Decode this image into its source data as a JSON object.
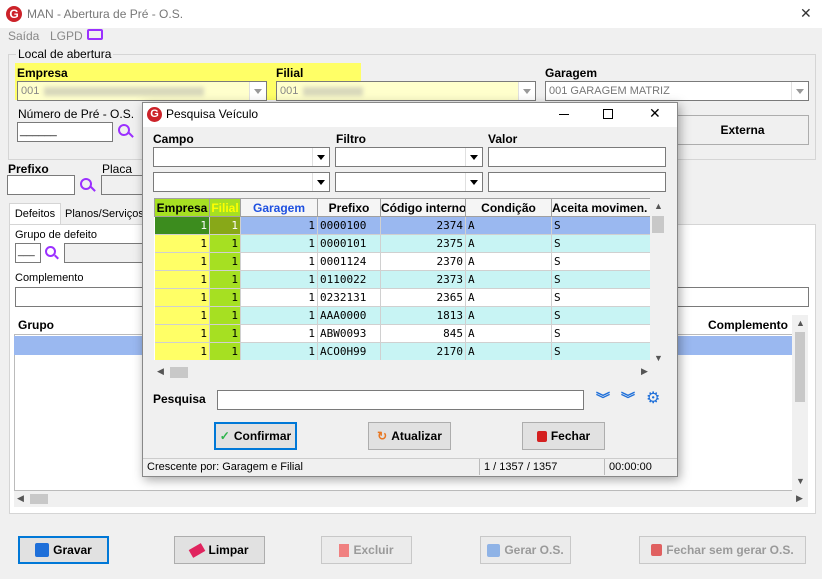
{
  "window": {
    "title": "MAN - Abertura de Pré - O.S.",
    "close": "✕"
  },
  "menu": {
    "saida": "Saída",
    "lgpd": "LGPD"
  },
  "local": {
    "group_label": "Local de abertura",
    "empresa_label": "Empresa",
    "empresa_value": "001",
    "filial_label": "Filial",
    "filial_value": "001",
    "garagem_label": "Garagem",
    "garagem_value": "001 GARAGEM MATRIZ",
    "numero_label": "Número de Pré - O.S.",
    "numero_value": "______",
    "externa_label": "Externa"
  },
  "prefixo_label": "Prefixo",
  "placa_label": "Placa",
  "tabs": [
    {
      "label": "Defeitos"
    },
    {
      "label": "Planos/Serviços"
    }
  ],
  "defeitos": {
    "grupo_defeito_label": "Grupo de defeito",
    "grupo_defeito_value": "___",
    "complemento_label": "Complemento",
    "columns": {
      "grupo": "Grupo",
      "complemento": "Complemento"
    }
  },
  "footer_buttons": {
    "gravar": "Gravar",
    "limpar": "Limpar",
    "excluir": "Excluir",
    "gerar": "Gerar O.S.",
    "fechar_sem": "Fechar sem gerar O.S."
  },
  "dialog": {
    "title": "Pesquisa Veículo",
    "campo_label": "Campo",
    "filtro_label": "Filtro",
    "valor_label": "Valor",
    "columns": [
      "Empresa",
      "Filial",
      "Garagem",
      "Prefixo",
      "Código interno",
      "Condição",
      "Aceita movimen."
    ],
    "rows": [
      [
        "1",
        "1",
        "1",
        "0000100",
        "2374",
        "A",
        "S"
      ],
      [
        "1",
        "1",
        "1",
        "0000101",
        "2375",
        "A",
        "S"
      ],
      [
        "1",
        "1",
        "1",
        "0001124",
        "2370",
        "A",
        "S"
      ],
      [
        "1",
        "1",
        "1",
        "0110022",
        "2373",
        "A",
        "S"
      ],
      [
        "1",
        "1",
        "1",
        "0232131",
        "2365",
        "A",
        "S"
      ],
      [
        "1",
        "1",
        "1",
        "AAA0000",
        "1813",
        "A",
        "S"
      ],
      [
        "1",
        "1",
        "1",
        "ABW0093",
        "845",
        "A",
        "S"
      ],
      [
        "1",
        "1",
        "1",
        "ACO0H99",
        "2170",
        "A",
        "S"
      ]
    ],
    "pesquisa_label": "Pesquisa",
    "buttons": {
      "confirmar": "Confirmar",
      "atualizar": "Atualizar",
      "fechar": "Fechar"
    },
    "status": {
      "order": "Crescente por: Garagem e Filial",
      "count": "1 / 1357 / 1357",
      "time": "00:00:00"
    }
  },
  "colors": {
    "accent": "#cc2229",
    "highlight": "#ffff66",
    "selected": "#9ab8f0",
    "row_alt": "#c8f4f4"
  }
}
